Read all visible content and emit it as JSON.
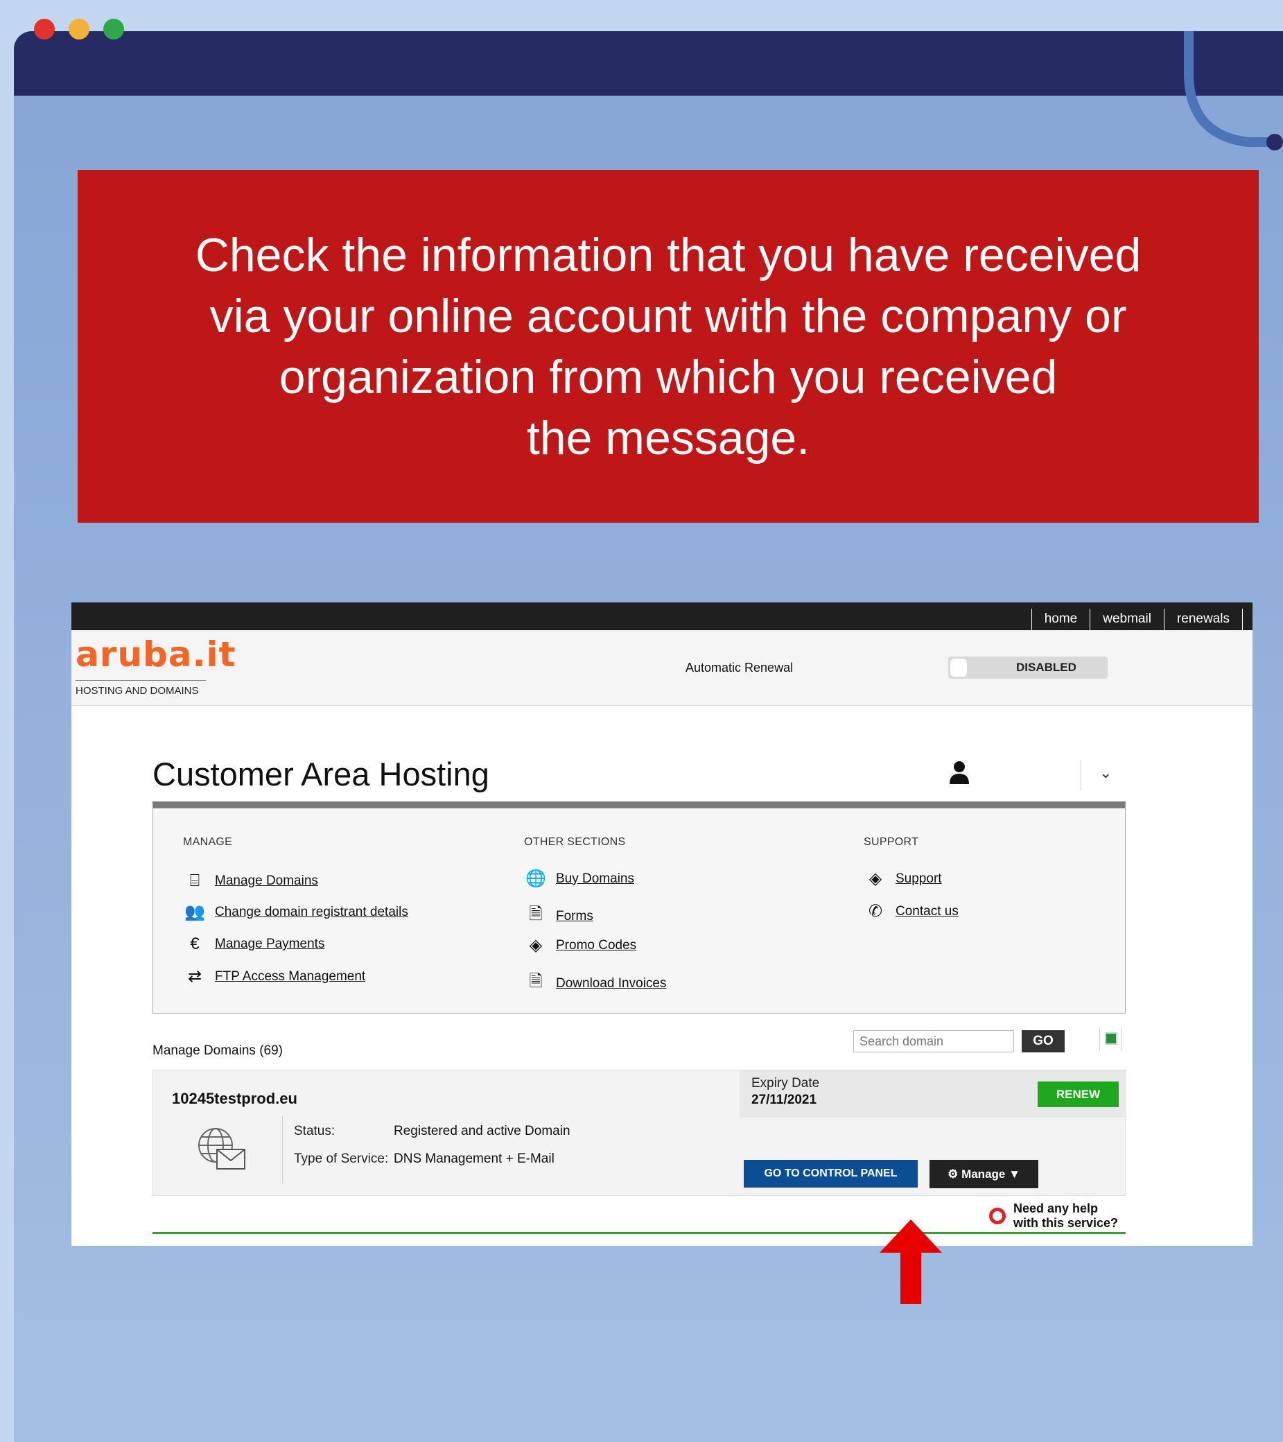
{
  "banner": {
    "text": "Check the information that you have received\nvia your online account with the company or\norganization from which you received\nthe message."
  },
  "screenshot": {
    "topnav": [
      "home",
      "webmail",
      "renewals"
    ],
    "logo": "aruba.it",
    "tagline": "HOSTING AND DOMAINS",
    "page_title": "Customer Area Hosting",
    "menu": {
      "manage": {
        "heading": "MANAGE",
        "items": [
          {
            "label": "Manage Domains",
            "icon": "server-www-icon"
          },
          {
            "label": "Change domain registrant details",
            "icon": "users-icon"
          },
          {
            "label": "Manage Payments",
            "icon": "euro-icon"
          },
          {
            "label": "FTP Access Management",
            "icon": "transfer-arrows-icon"
          }
        ]
      },
      "other": {
        "heading": "OTHER SECTIONS",
        "items": [
          {
            "label": "Buy Domains",
            "icon": "globe-cart-icon"
          },
          {
            "label": "Forms",
            "icon": "document-icon"
          },
          {
            "label": "Promo Codes",
            "icon": "ticket-icon"
          },
          {
            "label": "Download Invoices",
            "icon": "document-icon"
          }
        ]
      },
      "support": {
        "heading": "SUPPORT",
        "items": [
          {
            "label": "Support",
            "icon": "ticket-icon"
          },
          {
            "label": "Contact us",
            "icon": "phone-icon"
          }
        ]
      }
    },
    "domains_title": "Manage Domains (69)",
    "search_placeholder": "Search domain",
    "go_label": "GO",
    "domain": {
      "name": "10245testprod.eu",
      "status_label": "Status:",
      "status_value": "Registered and active Domain",
      "service_label": "Type of Service:",
      "service_value": "DNS Management + E-Mail",
      "expiry_label": "Expiry Date",
      "expiry_value": "27/11/2021",
      "renew_label": "RENEW",
      "auto_renewal_label": "Automatic Renewal",
      "auto_renewal_state": "DISABLED",
      "control_panel_label": "GO TO CONTROL PANEL",
      "manage_label": "Manage ▼"
    },
    "help_text": "Need any help\nwith this service?"
  },
  "colors": {
    "banner": "#bf1718",
    "titlebar": "#262c63",
    "renew": "#1da81d",
    "control_panel": "#0b4e96",
    "arrow": "#e60000"
  }
}
